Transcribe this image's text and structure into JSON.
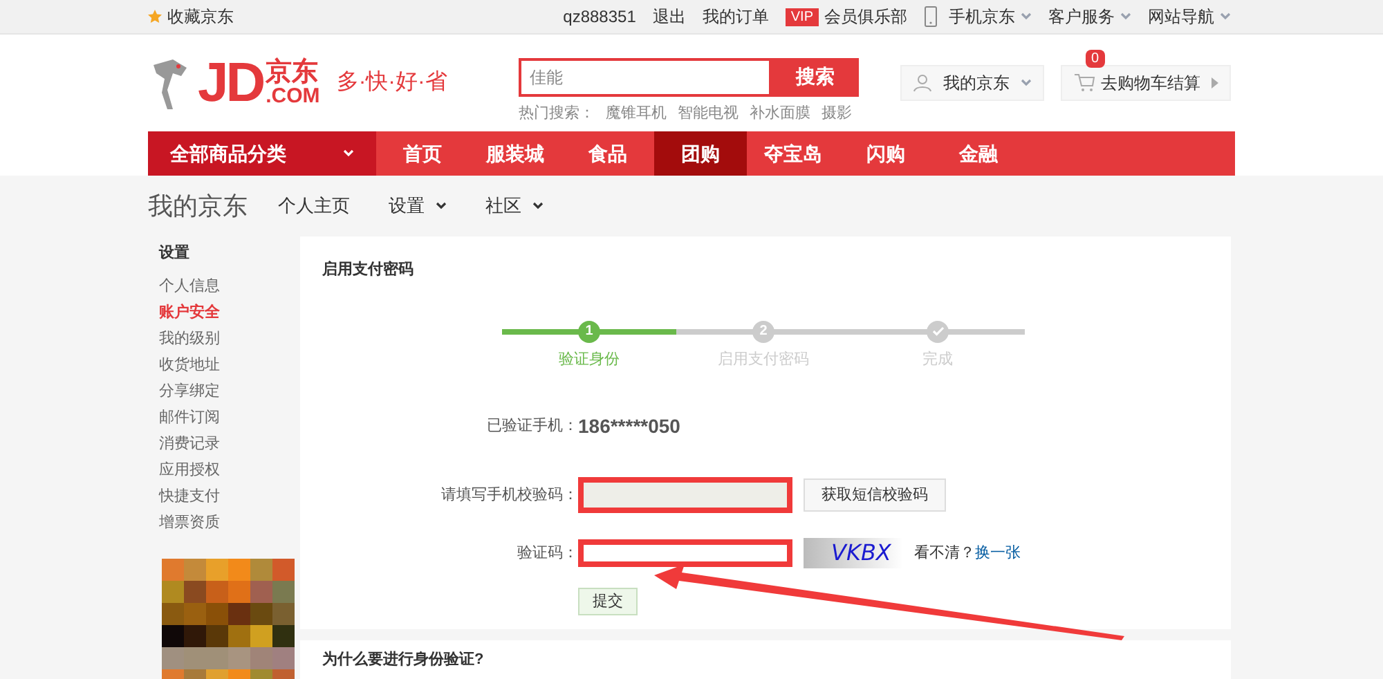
{
  "topbar": {
    "favorite": "收藏京东",
    "links": [
      {
        "text": "qz888351",
        "kind": "plain"
      },
      {
        "text": "退出",
        "kind": "plain"
      },
      {
        "text": "我的订单",
        "kind": "plain"
      },
      {
        "text": "会员俱乐部",
        "kind": "vip",
        "badge": "VIP"
      },
      {
        "text": "手机京东",
        "kind": "phone"
      },
      {
        "text": "客户服务",
        "kind": "menu"
      },
      {
        "text": "网站导航",
        "kind": "menu"
      }
    ]
  },
  "header": {
    "logo": "JD",
    "logo_cn": "京东",
    "logo_com": ".COM",
    "slogan": "多·快·好·省",
    "search": {
      "value": "佳能",
      "button": "搜索"
    },
    "hot_label": "热门搜索：",
    "hot": [
      "魔锥耳机",
      "智能电视",
      "补水面膜",
      "摄影"
    ],
    "my_jd": "我的京东",
    "cart": {
      "label": "去购物车结算",
      "count": "0"
    }
  },
  "nav": {
    "all": "全部商品分类",
    "items": [
      {
        "text": "首页",
        "selected": false
      },
      {
        "text": "服装城",
        "selected": false
      },
      {
        "text": "食品",
        "selected": false
      },
      {
        "text": "团购",
        "selected": true
      },
      {
        "text": "夺宝岛",
        "selected": false
      },
      {
        "text": "闪购",
        "selected": false
      },
      {
        "text": "金融",
        "selected": false
      }
    ]
  },
  "subnav": {
    "title": "我的京东",
    "items": [
      {
        "text": "个人主页",
        "dropdown": false
      },
      {
        "text": "设置",
        "dropdown": true
      },
      {
        "text": "社区",
        "dropdown": true
      }
    ]
  },
  "sidebar": {
    "heading": "设置",
    "items": [
      {
        "text": "个人信息",
        "selected": false
      },
      {
        "text": "账户安全",
        "selected": true
      },
      {
        "text": "我的级别",
        "selected": false
      },
      {
        "text": "收货地址",
        "selected": false
      },
      {
        "text": "分享绑定",
        "selected": false
      },
      {
        "text": "邮件订阅",
        "selected": false
      },
      {
        "text": "消费记录",
        "selected": false
      },
      {
        "text": "应用授权",
        "selected": false
      },
      {
        "text": "快捷支付",
        "selected": false
      },
      {
        "text": "增票资质",
        "selected": false
      }
    ]
  },
  "panel": {
    "title": "启用支付密码",
    "steps": [
      {
        "mark": "1",
        "label": "验证身份",
        "done": true,
        "kind": "number"
      },
      {
        "mark": "2",
        "label": "启用支付密码",
        "done": false,
        "kind": "number"
      },
      {
        "label": "完成",
        "done": false,
        "kind": "check"
      }
    ],
    "phone_label": "已验证手机：",
    "phone": "186*****050",
    "sms_label": "请填写手机校验码：",
    "sms_button": "获取短信校验码",
    "captcha_label": "验证码：",
    "captcha_text": "VKBX",
    "unclear": "看不清？",
    "refresh": "换一张",
    "submit": "提交"
  },
  "faq": {
    "title": "为什么要进行身份验证?"
  }
}
